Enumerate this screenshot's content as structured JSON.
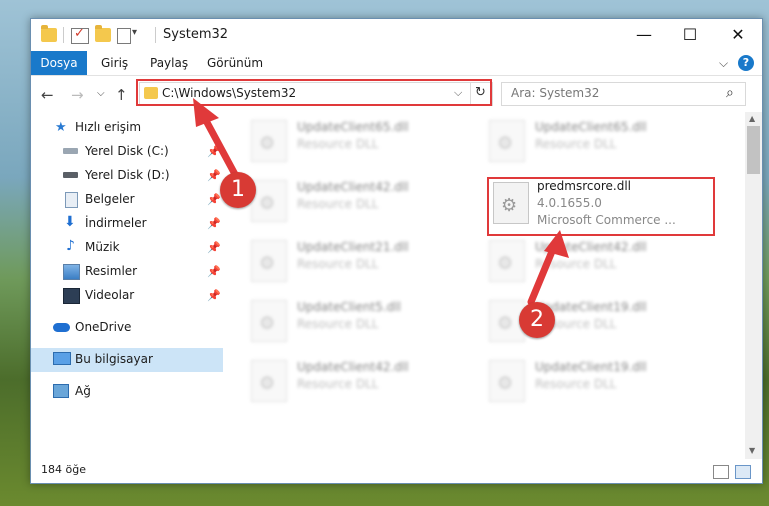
{
  "window": {
    "title": "System32",
    "controls": {
      "minimize": "—",
      "maximize": "☐",
      "close": "✕"
    }
  },
  "ribbon": {
    "tabs": [
      "Dosya",
      "Giriş",
      "Paylaş",
      "Görünüm"
    ],
    "collapse": "⌵",
    "help": "?"
  },
  "address": {
    "path": "C:\\Windows\\System32",
    "dropdown": "⌵",
    "refresh": "↻",
    "search_placeholder": "Ara: System32",
    "search_icon": "⌕"
  },
  "nav_buttons": {
    "back": "←",
    "forward": "→",
    "recent": "⌵",
    "up": "↑"
  },
  "sidebar": {
    "items": [
      {
        "label": "Hızlı erişim",
        "icon": "star-icon"
      },
      {
        "label": "Yerel Disk (C:)",
        "icon": "drive-icon",
        "pinned": true
      },
      {
        "label": "Yerel Disk (D:)",
        "icon": "drive-icon",
        "pinned": true
      },
      {
        "label": "Belgeler",
        "icon": "documents-icon",
        "pinned": true
      },
      {
        "label": "İndirmeler",
        "icon": "download-icon",
        "pinned": true
      },
      {
        "label": "Müzik",
        "icon": "music-icon",
        "pinned": true
      },
      {
        "label": "Resimler",
        "icon": "pictures-icon",
        "pinned": true
      },
      {
        "label": "Videolar",
        "icon": "video-icon",
        "pinned": true
      },
      {
        "label": "OneDrive",
        "icon": "cloud-icon"
      },
      {
        "label": "Bu bilgisayar",
        "icon": "computer-icon",
        "selected": true
      },
      {
        "label": "Ağ",
        "icon": "network-icon"
      }
    ],
    "pin_glyph": "📌"
  },
  "files": {
    "left": [
      {
        "name": "UpdateClient65.dll",
        "type": "Resource DLL"
      },
      {
        "name": "UpdateClient42.dll",
        "type": "Resource DLL"
      },
      {
        "name": "UpdateClient21.dll",
        "type": "Resource DLL"
      },
      {
        "name": "UpdateClient5.dll",
        "type": "Resource DLL"
      },
      {
        "name": "UpdateClient42.dll",
        "type": "Resource DLL"
      }
    ],
    "right": [
      {
        "name": "UpdateClient65.dll",
        "type": "Resource DLL"
      },
      {
        "name": "predmsrcore.dll",
        "type": "4.0.1655.0",
        "company": "Microsoft Commerce ...",
        "highlight": true
      },
      {
        "name": "UpdateClient42.dll",
        "type": "Resource DLL"
      },
      {
        "name": "UpdateClient19.dll",
        "type": "Resource DLL"
      },
      {
        "name": "UpdateClient19.dll",
        "type": "Resource DLL"
      }
    ]
  },
  "status": {
    "count": "184 öğe"
  },
  "annotations": {
    "one": "1",
    "two": "2"
  },
  "colors": {
    "accent": "#1979ca",
    "highlight_border": "#e0393a",
    "badge": "#d83a34"
  }
}
